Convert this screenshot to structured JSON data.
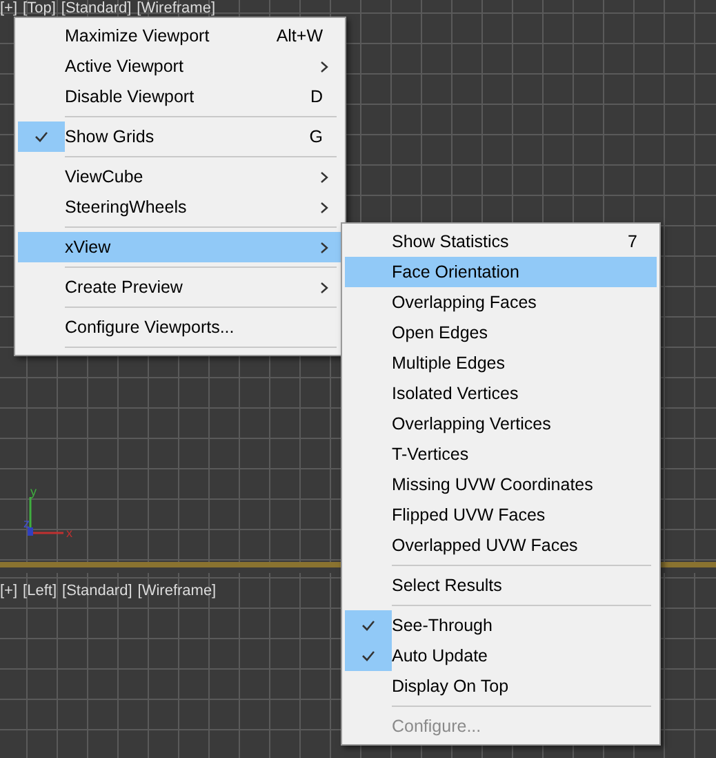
{
  "viewports": [
    {
      "labels": [
        "[+]",
        "[Top]",
        "[Standard]",
        "[Wireframe]"
      ],
      "active": true
    },
    {
      "labels": [
        "[+]",
        "[Left]",
        "[Standard]",
        "[Wireframe]"
      ],
      "active": false
    }
  ],
  "axis_gizmo": {
    "labels": [
      "y",
      "z",
      "x"
    ]
  },
  "context_menu": {
    "items": [
      {
        "kind": "item",
        "label": "Maximize Viewport",
        "shortcut": "Alt+W",
        "has_submenu": false,
        "checked": false,
        "selected": false
      },
      {
        "kind": "item",
        "label": "Active Viewport",
        "has_submenu": true,
        "checked": false,
        "selected": false
      },
      {
        "kind": "item",
        "label": "Disable Viewport",
        "shortcut": "D",
        "has_submenu": false,
        "checked": false,
        "selected": false
      },
      {
        "kind": "separator"
      },
      {
        "kind": "item",
        "label": "Show Grids",
        "shortcut": "G",
        "has_submenu": false,
        "checked": true,
        "selected": false
      },
      {
        "kind": "separator"
      },
      {
        "kind": "item",
        "label": "ViewCube",
        "has_submenu": true,
        "checked": false,
        "selected": false
      },
      {
        "kind": "item",
        "label": "SteeringWheels",
        "has_submenu": true,
        "checked": false,
        "selected": false
      },
      {
        "kind": "separator"
      },
      {
        "kind": "item",
        "label": "xView",
        "has_submenu": true,
        "checked": false,
        "selected": true
      },
      {
        "kind": "separator"
      },
      {
        "kind": "item",
        "label": "Create Preview",
        "has_submenu": true,
        "checked": false,
        "selected": false
      },
      {
        "kind": "separator"
      },
      {
        "kind": "item",
        "label": "Configure Viewports...",
        "has_submenu": false,
        "checked": false,
        "selected": false
      },
      {
        "kind": "separator"
      }
    ]
  },
  "submenu": {
    "items": [
      {
        "kind": "item",
        "label": "Show Statistics",
        "shortcut": "7",
        "checked": false,
        "selected": false,
        "disabled": false
      },
      {
        "kind": "item",
        "label": "Face Orientation",
        "checked": false,
        "selected": true,
        "disabled": false
      },
      {
        "kind": "item",
        "label": "Overlapping Faces",
        "checked": false,
        "selected": false,
        "disabled": false
      },
      {
        "kind": "item",
        "label": "Open Edges",
        "checked": false,
        "selected": false,
        "disabled": false
      },
      {
        "kind": "item",
        "label": "Multiple Edges",
        "checked": false,
        "selected": false,
        "disabled": false
      },
      {
        "kind": "item",
        "label": "Isolated Vertices",
        "checked": false,
        "selected": false,
        "disabled": false
      },
      {
        "kind": "item",
        "label": "Overlapping Vertices",
        "checked": false,
        "selected": false,
        "disabled": false
      },
      {
        "kind": "item",
        "label": "T-Vertices",
        "checked": false,
        "selected": false,
        "disabled": false
      },
      {
        "kind": "item",
        "label": "Missing UVW Coordinates",
        "checked": false,
        "selected": false,
        "disabled": false
      },
      {
        "kind": "item",
        "label": "Flipped UVW Faces",
        "checked": false,
        "selected": false,
        "disabled": false
      },
      {
        "kind": "item",
        "label": "Overlapped UVW Faces",
        "checked": false,
        "selected": false,
        "disabled": false
      },
      {
        "kind": "separator"
      },
      {
        "kind": "item",
        "label": "Select Results",
        "checked": false,
        "selected": false,
        "disabled": false
      },
      {
        "kind": "separator"
      },
      {
        "kind": "item",
        "label": "See-Through",
        "checked": true,
        "selected": false,
        "disabled": false
      },
      {
        "kind": "item",
        "label": "Auto Update",
        "checked": true,
        "selected": false,
        "disabled": false
      },
      {
        "kind": "item",
        "label": "Display On Top",
        "checked": false,
        "selected": false,
        "disabled": false
      },
      {
        "kind": "separator"
      },
      {
        "kind": "item",
        "label": "Configure...",
        "checked": false,
        "selected": false,
        "disabled": true
      }
    ]
  }
}
